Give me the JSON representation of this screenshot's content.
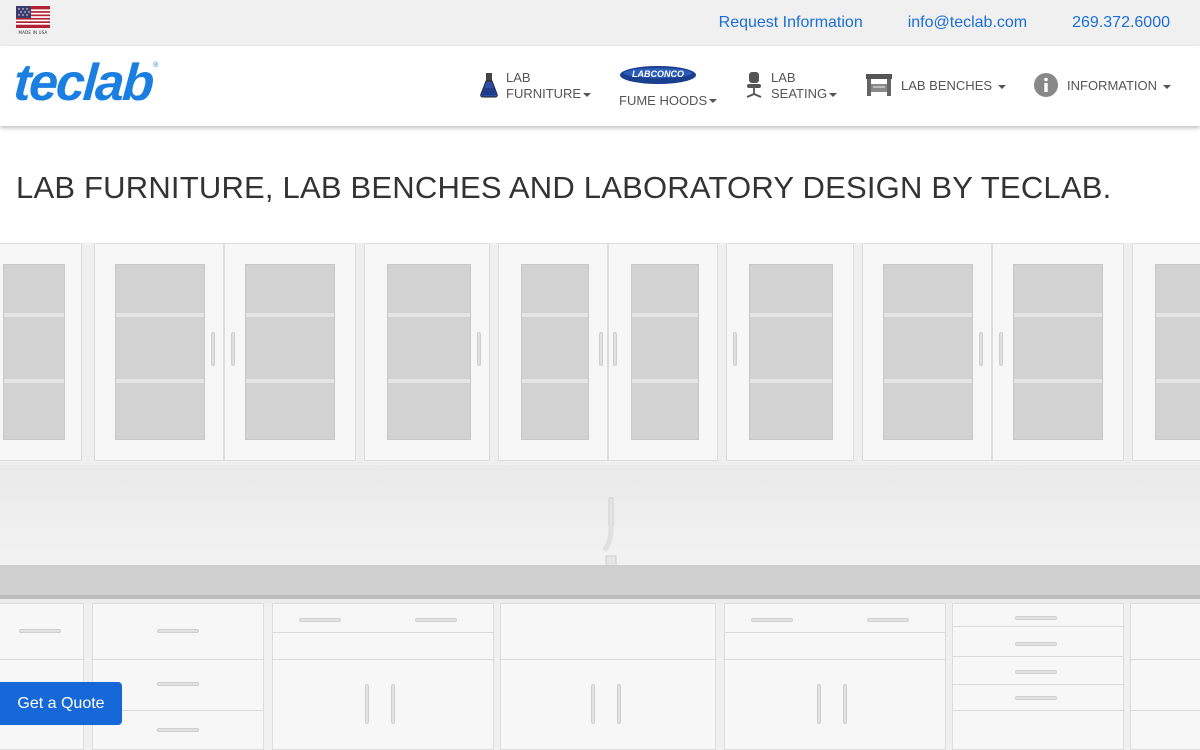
{
  "topbar": {
    "made_in_usa": "MADE IN USA",
    "links": {
      "request_info": "Request Information",
      "email": "info@teclab.com",
      "phone": "269.372.6000"
    }
  },
  "brand": {
    "logo": "teclab",
    "logo_color": "#1a7fe0"
  },
  "nav": {
    "lab_furniture": {
      "line1": "LAB",
      "line2": "FURNITURE",
      "icon": "flask-icon"
    },
    "fume_hoods": {
      "badge": "LABCONCO",
      "label": "FUME HOODS",
      "icon": "labconco-logo-icon"
    },
    "lab_seating": {
      "line1": "LAB",
      "line2": "SEATING",
      "icon": "chair-icon"
    },
    "lab_benches": {
      "label": "LAB BENCHES",
      "icon": "bench-icon"
    },
    "information": {
      "label": "INFORMATION",
      "icon": "info-icon"
    }
  },
  "main": {
    "headline": "LAB FURNITURE, LAB BENCHES AND LABORATORY DESIGN BY TECLAB."
  },
  "cta": {
    "quote": "Get a Quote",
    "color": "#1668d8"
  }
}
